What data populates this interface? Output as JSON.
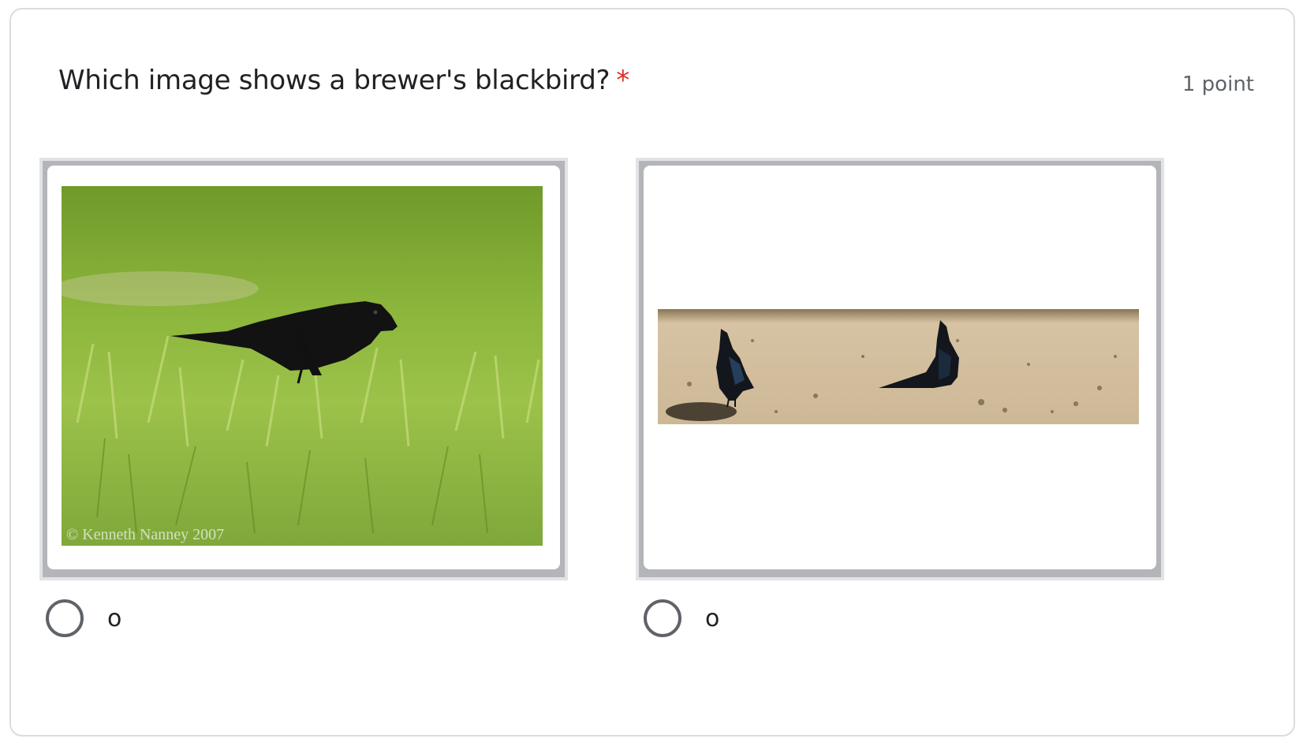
{
  "question": {
    "text": "Which image shows a brewer's blackbird?",
    "required_marker": "*",
    "points": "1 point"
  },
  "options": [
    {
      "label": "o",
      "image_watermark": "© Kenneth Nanney 2007",
      "icon": "photo-blackbird-grass"
    },
    {
      "label": "o",
      "icon": "photo-grackles-sand"
    }
  ],
  "colors": {
    "required": "#d93025",
    "points": "#5f6368",
    "radio_border": "#5f6368",
    "card_border": "#dadce0"
  }
}
